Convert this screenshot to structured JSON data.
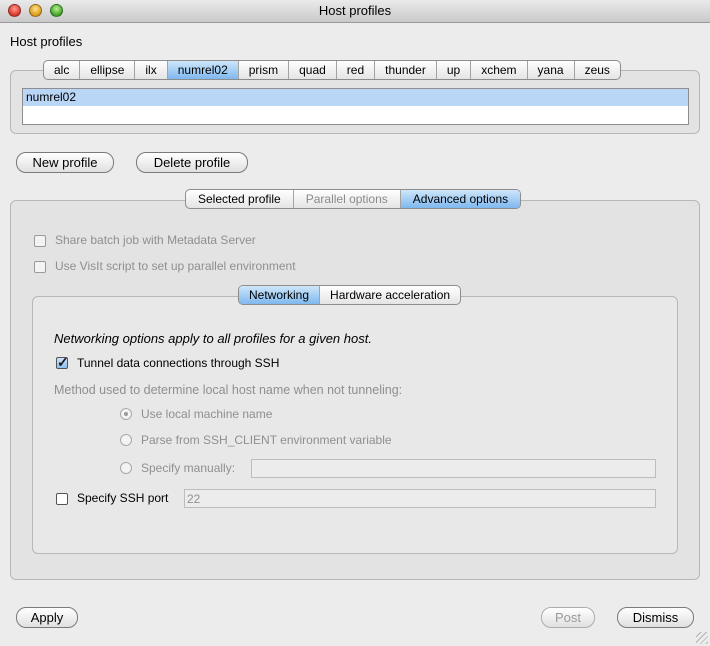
{
  "window": {
    "title": "Host profiles"
  },
  "header": {
    "label": "Host profiles"
  },
  "host_tabs": [
    {
      "label": "alc",
      "selected": false
    },
    {
      "label": "ellipse",
      "selected": false
    },
    {
      "label": "ilx",
      "selected": false
    },
    {
      "label": "numrel02",
      "selected": true
    },
    {
      "label": "prism",
      "selected": false
    },
    {
      "label": "quad",
      "selected": false
    },
    {
      "label": "red",
      "selected": false
    },
    {
      "label": "thunder",
      "selected": false
    },
    {
      "label": "up",
      "selected": false
    },
    {
      "label": "xchem",
      "selected": false
    },
    {
      "label": "yana",
      "selected": false
    },
    {
      "label": "zeus",
      "selected": false
    }
  ],
  "profile_list": {
    "items": [
      "numrel02"
    ]
  },
  "buttons": {
    "new_profile": "New profile",
    "delete_profile": "Delete profile",
    "apply": "Apply",
    "post": "Post",
    "dismiss": "Dismiss"
  },
  "profile_tabs": [
    {
      "label": "Selected profile",
      "state": "normal"
    },
    {
      "label": "Parallel options",
      "state": "disabled"
    },
    {
      "label": "Advanced options",
      "state": "selected"
    }
  ],
  "advanced": {
    "share_batch": {
      "label": "Share batch job with Metadata Server",
      "checked": false,
      "enabled": false
    },
    "visit_script": {
      "label": "Use VisIt script to set up parallel environment",
      "checked": false,
      "enabled": false
    }
  },
  "sub_tabs": [
    {
      "label": "Networking",
      "state": "selected"
    },
    {
      "label": "Hardware acceleration",
      "state": "normal"
    }
  ],
  "networking": {
    "note": "Networking options apply to all profiles for a given host.",
    "tunnel": {
      "label": "Tunnel data connections through SSH",
      "checked": true
    },
    "method_label": "Method used to determine local host name when not tunneling:",
    "radios": [
      {
        "label": "Use local machine name",
        "selected": true
      },
      {
        "label": "Parse from SSH_CLIENT environment variable",
        "selected": false
      },
      {
        "label": "Specify manually:",
        "selected": false
      }
    ],
    "manual_value": "",
    "ssh_port": {
      "label": "Specify SSH port",
      "checked": false,
      "value": "22"
    }
  },
  "colors": {
    "selection": "#b9d6f7",
    "tab_selected": "#7fb8ef",
    "disabled_text": "#8f8f8f"
  }
}
